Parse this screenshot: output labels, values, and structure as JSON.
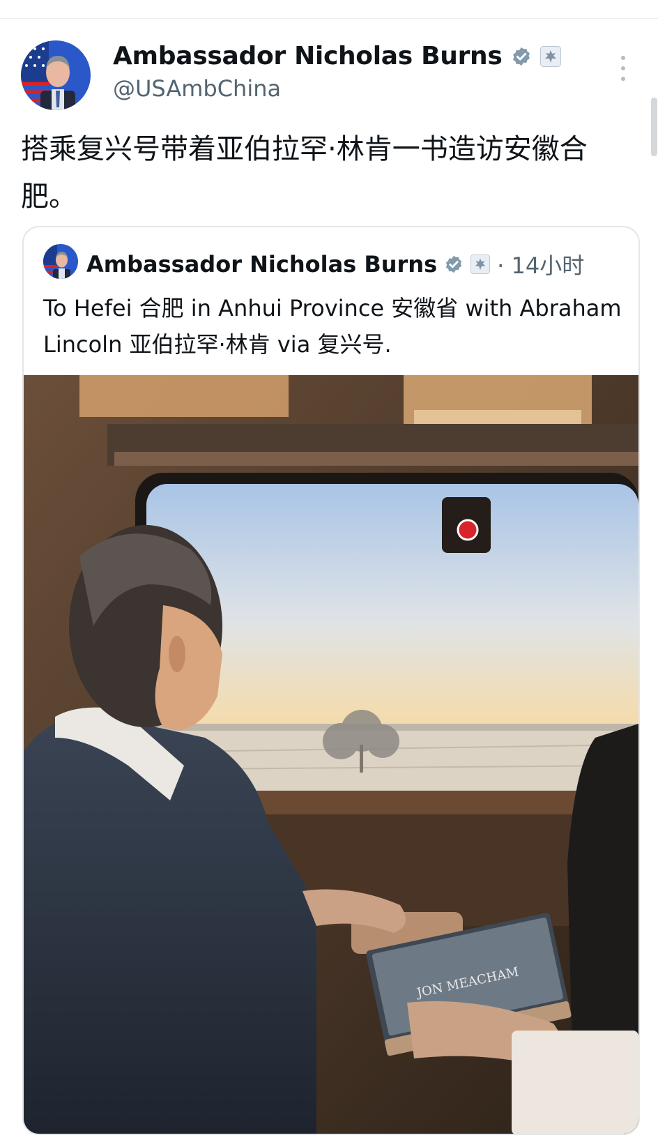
{
  "post": {
    "author": {
      "name": "Ambassador Nicholas Burns",
      "handle": "@USAmbChina",
      "avatar_icon": "avatar-portrait-flag",
      "badges": [
        "verified-badge-icon",
        "embassy-seal-icon"
      ]
    },
    "text": "搭乘复兴号带着亚伯拉罕·林肯一书造访安徽合肥。",
    "more_icon": "more-vertical-icon"
  },
  "quoted": {
    "author": {
      "name": "Ambassador Nicholas Burns",
      "badges": [
        "verified-badge-icon",
        "embassy-seal-icon"
      ]
    },
    "time": "· 14小时",
    "text": "To Hefei 合肥 in Anhui Province 安徽省 with Abraham Lincoln 亚伯拉罕·林肯 via 复兴号.",
    "image": {
      "subject": "photo-man-reading-on-train",
      "book_text": "JON MEACHAM"
    }
  },
  "colors": {
    "text": "#0f1419",
    "muted": "#536471",
    "verified": "#829aab",
    "border": "#e3e7ea"
  }
}
